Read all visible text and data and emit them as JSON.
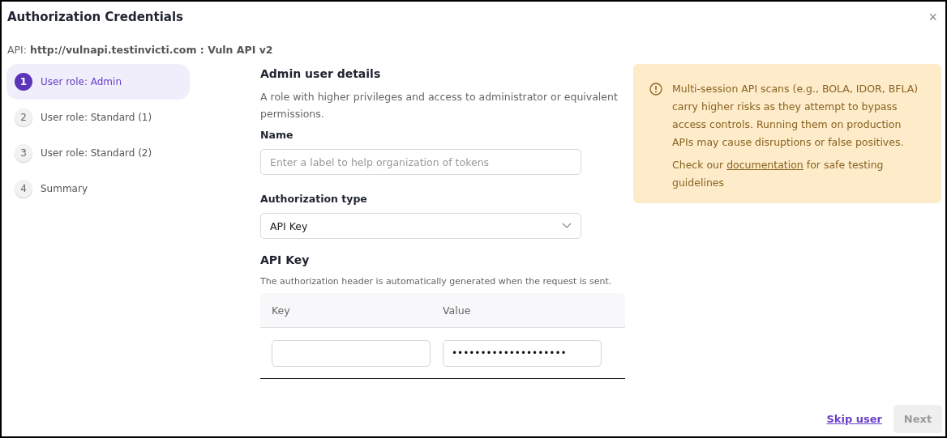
{
  "window": {
    "title": "Authorization Credentials",
    "close": "×"
  },
  "api": {
    "label": "API:",
    "value": "http://vulnapi.testinvicti.com : Vuln API v2"
  },
  "steps": [
    {
      "number": "1",
      "label": "User role: Admin",
      "selected": true
    },
    {
      "number": "2",
      "label": "User role: Standard (1)",
      "selected": false
    },
    {
      "number": "3",
      "label": "User role: Standard (2)",
      "selected": false
    },
    {
      "number": "4",
      "label": "Summary",
      "selected": false
    }
  ],
  "form": {
    "heading": "Admin user details",
    "description": "A role with higher privileges and access to administrator or equivalent permissions.",
    "name_label": "Name",
    "name_placeholder": "Enter a label to help organization of tokens",
    "type_label": "Authorization type",
    "type_value": "API Key",
    "section": "API Key",
    "section_note": "The authorization header is automatically generated when the request is sent.",
    "table": {
      "columns": [
        "Key",
        "Value"
      ],
      "rows": [
        {
          "key": "",
          "value": "••••••••••••••••••••"
        }
      ]
    }
  },
  "alert": {
    "text": "Multi-session API scans (e.g., BOLA, IDOR, BFLA) carry higher risks as they attempt to bypass access controls. Running them on production APIs may cause disruptions or false positives.",
    "note_before": "Check our",
    "link": "documentation",
    "note_after": "for safe testing guidelines"
  },
  "footer": {
    "skip": "Skip user",
    "next": {
      "label": "Next",
      "disabled": true
    }
  }
}
